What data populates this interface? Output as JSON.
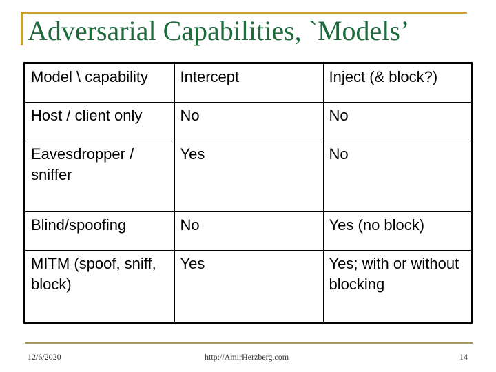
{
  "slide": {
    "title": "Adversarial Capabilities, `Models’",
    "accent_color": "#c9a235",
    "title_color": "#1e6b3c"
  },
  "table": {
    "headers": [
      "Model \\ capability",
      "Intercept",
      "Inject (& block?)"
    ],
    "rows": [
      [
        "Host / client only",
        "No",
        "No"
      ],
      [
        "Eavesdropper / sniffer",
        "Yes",
        "No"
      ],
      [
        "Blind/spoofing",
        "No",
        "Yes (no block)"
      ],
      [
        "MITM (spoof, sniff, block)",
        "Yes",
        "Yes; with or without blocking"
      ]
    ]
  },
  "footer": {
    "date": "12/6/2020",
    "url": "http://AmirHerzberg.com",
    "page": "14"
  }
}
